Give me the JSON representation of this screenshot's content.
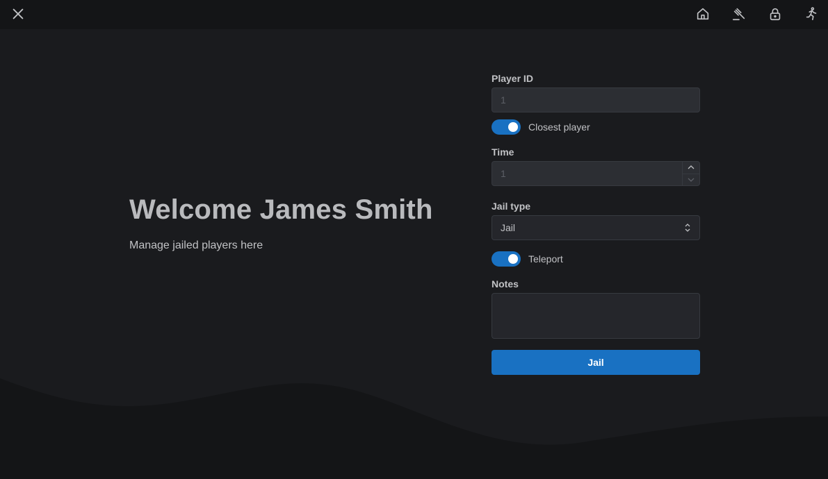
{
  "icons": {
    "close": "close-icon",
    "home": "home-icon",
    "gavel": "gavel-icon",
    "lock": "lock-icon",
    "run": "running-person-icon"
  },
  "colors": {
    "accent": "#1971c2",
    "background": "#1a1b1e",
    "topbar": "#141517"
  },
  "hero": {
    "title": "Welcome James Smith",
    "subtitle": "Manage jailed players here"
  },
  "form": {
    "player_id": {
      "label": "Player ID",
      "placeholder": "1"
    },
    "closest_player": {
      "label": "Closest player",
      "checked": true
    },
    "time": {
      "label": "Time",
      "placeholder": "1"
    },
    "jail_type": {
      "label": "Jail type",
      "value": "Jail"
    },
    "teleport": {
      "label": "Teleport",
      "checked": true
    },
    "notes": {
      "label": "Notes",
      "value": ""
    },
    "submit_label": "Jail"
  }
}
